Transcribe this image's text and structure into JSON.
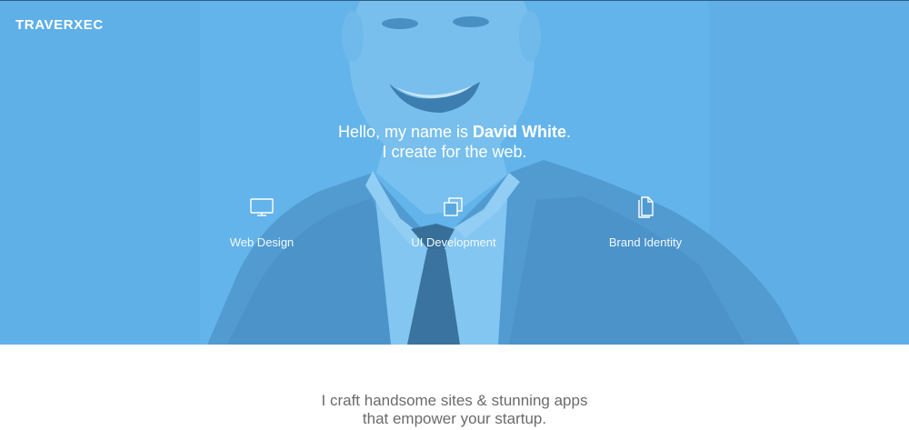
{
  "header": {
    "brand": "TRAVERXEC"
  },
  "hero": {
    "greeting_prefix": "Hello, my name is ",
    "name": "David White",
    "greeting_suffix": ".",
    "tagline": "I create for the web.",
    "services": [
      {
        "label": "Web Design",
        "icon": "monitor-icon"
      },
      {
        "label": "UI Development",
        "icon": "layers-icon"
      },
      {
        "label": "Brand Identity",
        "icon": "document-icon"
      }
    ]
  },
  "about": {
    "line1": "I craft handsome sites & stunning apps",
    "line2": "that empower your startup."
  },
  "colors": {
    "hero_blue": "#62b2e8",
    "text_gray": "#6b6b6b"
  }
}
